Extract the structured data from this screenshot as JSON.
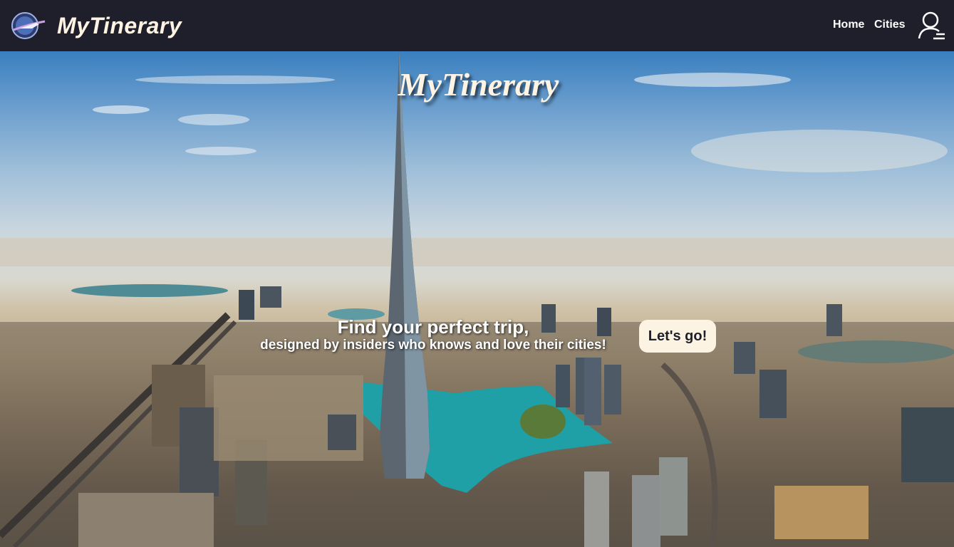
{
  "navbar": {
    "brand": "MyTinerary",
    "logo_icon": "plane-globe-icon",
    "links": [
      {
        "label": "Home"
      },
      {
        "label": "Cities"
      }
    ],
    "user_icon": "user-login-icon",
    "background": "#1e1f2a"
  },
  "hero": {
    "title": "MyTinerary",
    "tagline_line1": "Find your perfect trip,",
    "tagline_line2": "designed by insiders who knows and love their cities!",
    "cta_label": "Let's go!",
    "cta_color": "#fdf3e3"
  }
}
